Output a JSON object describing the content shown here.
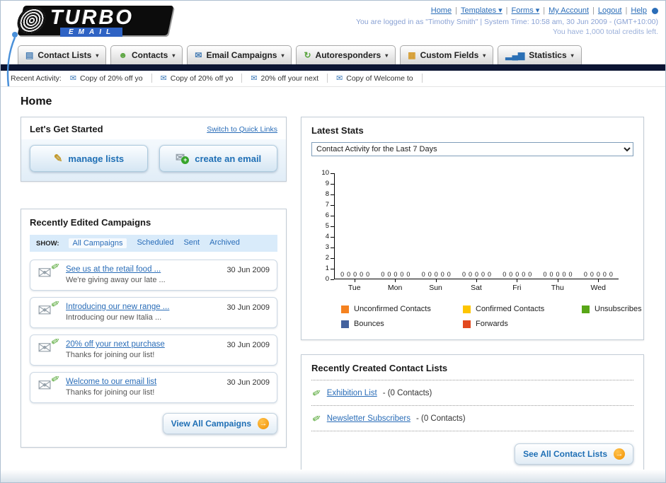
{
  "header": {
    "logo_top": "TURBO",
    "logo_bottom": "EMAIL",
    "links": [
      {
        "label": "Home",
        "dropdown": false
      },
      {
        "label": "Templates",
        "dropdown": true
      },
      {
        "label": "Forms",
        "dropdown": true
      },
      {
        "label": "My Account",
        "dropdown": false
      },
      {
        "label": "Logout",
        "dropdown": false
      },
      {
        "label": "Help",
        "dropdown": false
      }
    ],
    "login_info": "You are logged in as \"Timothy Smith\" | System Time: 10:58 am, 30 Jun 2009 - (GMT+10:00)",
    "credits": "You have 1,000 total credits left."
  },
  "nav": {
    "tabs": [
      {
        "label": "Contact Lists",
        "icon": "contact-lists-icon"
      },
      {
        "label": "Contacts",
        "icon": "contacts-icon"
      },
      {
        "label": "Email Campaigns",
        "icon": "email-campaigns-icon"
      },
      {
        "label": "Autoresponders",
        "icon": "autoresponders-icon"
      },
      {
        "label": "Custom Fields",
        "icon": "custom-fields-icon"
      },
      {
        "label": "Statistics",
        "icon": "statistics-icon"
      }
    ]
  },
  "recent_activity": {
    "label": "Recent Activity:",
    "items": [
      "Copy of 20% off yo",
      "Copy of 20% off yo",
      "20% off your next",
      "Copy of Welcome to"
    ]
  },
  "page_title": "Home",
  "get_started": {
    "title": "Let's Get Started",
    "switch_link": "Switch to Quick Links",
    "manage_lists_label": "manage lists",
    "create_email_label": "create an email"
  },
  "campaigns": {
    "title": "Recently Edited Campaigns",
    "show_label": "SHOW:",
    "filters": [
      {
        "label": "All Campaigns",
        "selected": true
      },
      {
        "label": "Scheduled",
        "selected": false
      },
      {
        "label": "Sent",
        "selected": false
      },
      {
        "label": "Archived",
        "selected": false
      }
    ],
    "items": [
      {
        "title": "See us at the retail food ...",
        "subtitle": "We're giving away our late ...",
        "date": "30 Jun 2009"
      },
      {
        "title": "Introducing our new range ...",
        "subtitle": "Introducing our new Italia ...",
        "date": "30 Jun 2009"
      },
      {
        "title": "20% off your next purchase",
        "subtitle": "Thanks for joining our list!",
        "date": "30 Jun 2009"
      },
      {
        "title": "Welcome to our email list",
        "subtitle": "Thanks for joining our list!",
        "date": "30 Jun 2009"
      }
    ],
    "view_all_label": "View All Campaigns"
  },
  "stats": {
    "title": "Latest Stats",
    "period_selected": "Contact Activity for the Last 7 Days",
    "chart_data": {
      "type": "bar",
      "title": "Contact Activity for the Last 7 Days",
      "categories": [
        "Tue",
        "Mon",
        "Sun",
        "Sat",
        "Fri",
        "Thu",
        "Wed"
      ],
      "series": [
        {
          "name": "Unconfirmed Contacts",
          "color": "#f58220",
          "values": [
            0,
            0,
            0,
            0,
            0,
            0,
            0
          ]
        },
        {
          "name": "Confirmed Contacts",
          "color": "#fdc500",
          "values": [
            0,
            0,
            0,
            0,
            0,
            0,
            0
          ]
        },
        {
          "name": "Unsubscribes",
          "color": "#58a618",
          "values": [
            0,
            0,
            0,
            0,
            0,
            0,
            0
          ]
        },
        {
          "name": "Bounces",
          "color": "#44629e",
          "values": [
            0,
            0,
            0,
            0,
            0,
            0,
            0
          ]
        },
        {
          "name": "Forwards",
          "color": "#e2491f",
          "values": [
            0,
            0,
            0,
            0,
            0,
            0,
            0
          ]
        }
      ],
      "ylim": [
        0,
        10
      ],
      "ytick_step": 1,
      "show_value_labels": true,
      "grid": false,
      "legend_position": "bottom"
    }
  },
  "contact_lists": {
    "title": "Recently Created Contact Lists",
    "items": [
      {
        "name": "Exhibition List",
        "detail": "- (0 Contacts)"
      },
      {
        "name": "Newsletter Subscribers",
        "detail": "- (0 Contacts)"
      }
    ],
    "see_all_label": "See All Contact Lists"
  }
}
